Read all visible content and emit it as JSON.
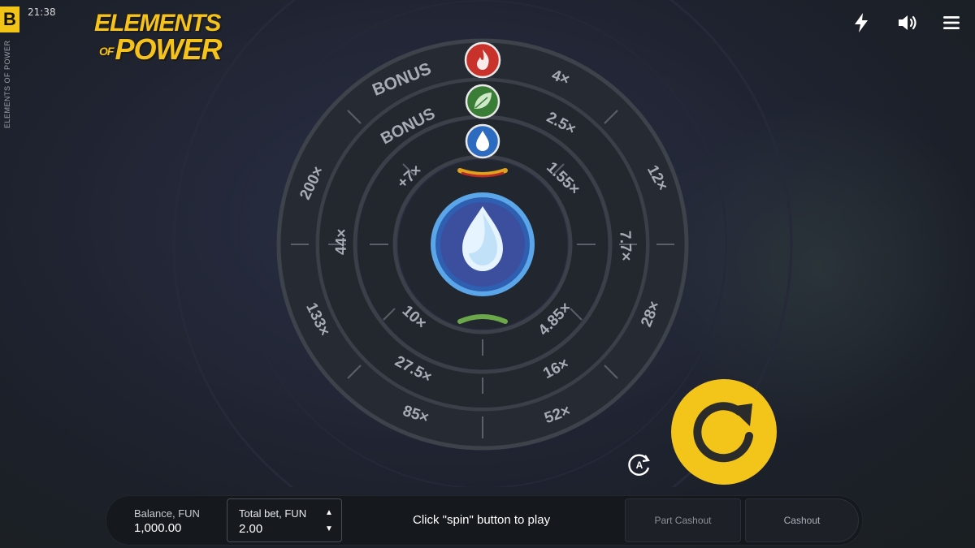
{
  "header": {
    "brand_badge": "B",
    "clock": "21:38",
    "vertical_title": "ELEMENTS OF POWER",
    "logo": {
      "line1": "ELEMENTS",
      "line2_of": "OF",
      "line2_main": "POWER"
    },
    "icons": [
      "lightning-icon",
      "sound-icon",
      "menu-icon"
    ]
  },
  "wheel": {
    "outer_ring": {
      "labels": [
        "BONUS",
        "4×",
        "12×",
        "28×",
        "52×",
        "85×",
        "133×",
        "200×"
      ],
      "element": "fire-icon"
    },
    "middle_ring": {
      "labels": [
        "BONUS",
        "2.5×",
        "7.7×",
        "16×",
        "27.5×",
        "44×"
      ],
      "element": "leaf-icon"
    },
    "inner_ring": {
      "labels": [
        "1.55×",
        "4.85×",
        "10×",
        "+7×"
      ],
      "element": "water-drop-icon"
    },
    "center": {
      "element": "water-drop-icon"
    }
  },
  "controls": {
    "spin_icon": "rotate-icon",
    "auto_icon": "auto-spin-icon"
  },
  "bottom_bar": {
    "balance_label": "Balance, FUN",
    "balance_value": "1,000.00",
    "bet_label": "Total bet, FUN",
    "bet_value": "2.00",
    "status": "Click \"spin\" button to play",
    "part_cashout": "Part Cashout",
    "cashout": "Cashout"
  },
  "colors": {
    "accent": "#f3c51b",
    "fire": "#d6342b",
    "leaf": "#3f8a3a",
    "water": "#2b7de0",
    "background": "#222636"
  }
}
